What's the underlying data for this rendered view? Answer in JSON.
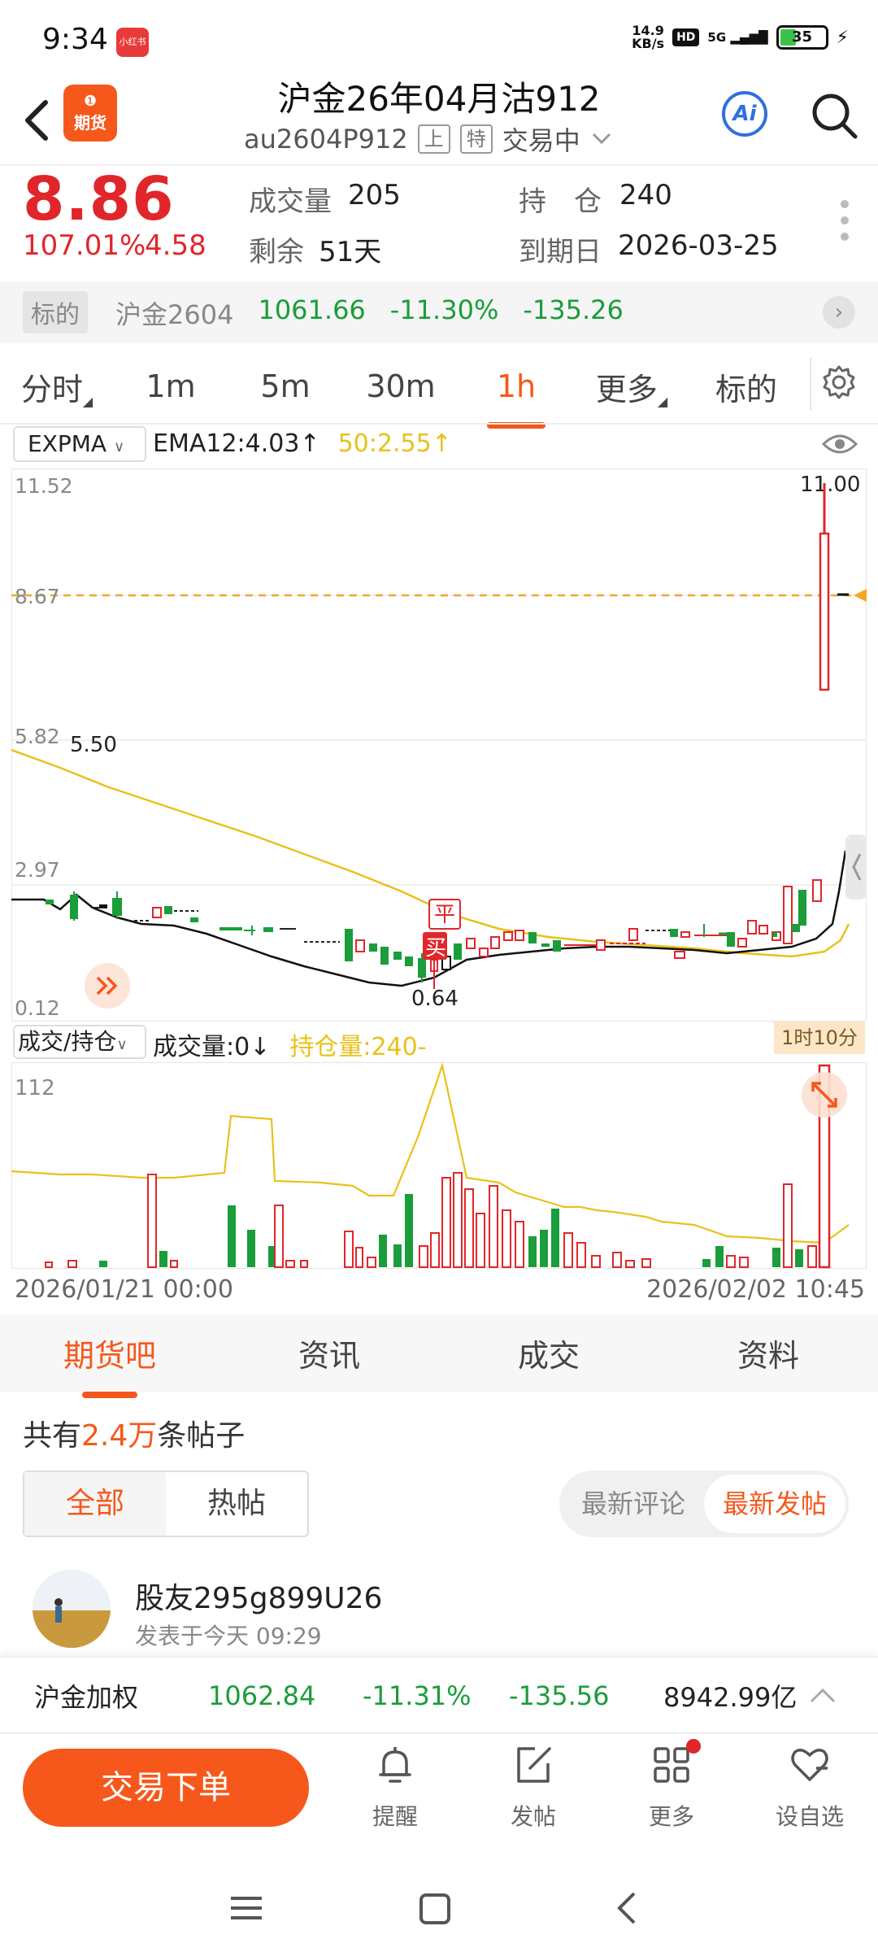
{
  "status": {
    "time": "9:34",
    "app_badge": "小红书",
    "speed_value": "14.9",
    "speed_unit": "KB/s",
    "hd": "HD",
    "network": "5G",
    "battery": "35"
  },
  "header": {
    "logo_line1": "❶",
    "logo_text": "期货",
    "title": "沪金26年04月沽912",
    "code": "au2604P912",
    "tag1": "上",
    "tag2": "特",
    "trade_status": "交易中",
    "ai_label": "Ai"
  },
  "quote": {
    "price": "8.86",
    "pct": "107.01%",
    "change": "4.58",
    "volume_label": "成交量",
    "volume": "205",
    "oi_label": "持　仓",
    "oi": "240",
    "remain_label": "剩余",
    "remain": "51天",
    "expiry_label": "到期日",
    "expiry": "2026-03-25"
  },
  "underlying": {
    "label": "标的",
    "name": "沪金2604",
    "price": "1061.66",
    "pct": "-11.30%",
    "change": "-135.26"
  },
  "period_tabs": [
    "分时",
    "1m",
    "5m",
    "30m",
    "1h",
    "更多",
    "标的"
  ],
  "active_period": "1h",
  "indicator": {
    "name": "EXPMA",
    "ema12": "EMA12:4.03",
    "ema50": "50:2.55"
  },
  "main_chart": {
    "y_ticks": [
      "11.52",
      "8.67",
      "5.82",
      "2.97",
      "0.12"
    ],
    "high_label": "11.00",
    "low_label": "0.64",
    "mid_label": "5.50",
    "flat_badge": "平",
    "buy_badge": "买"
  },
  "volume_panel": {
    "selector": "成交/持仓",
    "volume_label": "成交量:0",
    "oi_label": "持仓量:240-",
    "y_max": "112",
    "time_badge": "1时10分",
    "x_start": "2026/01/21 00:00",
    "x_end": "2026/02/02 10:45"
  },
  "news_tabs": [
    "期货吧",
    "资讯",
    "成交",
    "资料"
  ],
  "posts": {
    "count_prefix": "共有",
    "count": "2.4万",
    "count_suffix": "条帖子",
    "filter_all": "全部",
    "filter_hot": "热帖",
    "sort_comment": "最新评论",
    "sort_post": "最新发帖",
    "first_user": "股友295g899U26",
    "first_time": "发表于今天 09:29"
  },
  "ticker": {
    "name": "沪金加权",
    "price": "1062.84",
    "pct": "-11.31%",
    "change": "-135.56",
    "amount": "8942.99亿"
  },
  "bottom": {
    "trade": "交易下单",
    "remind": "提醒",
    "post": "发帖",
    "more": "更多",
    "watch": "设自选"
  },
  "colors": {
    "accent": "#f6581c",
    "up": "#e0262b",
    "down": "#1a9d3a",
    "ema50": "#e8c21a"
  },
  "chart_data": {
    "type": "candlestick",
    "indicators": {
      "EMA12": 4.03,
      "EMA50": 2.55
    },
    "y_range": [
      0.12,
      11.52
    ],
    "annotations": {
      "high": 11.0,
      "low": 0.64,
      "peak_left": 5.5,
      "last": 8.67
    },
    "volume_max": 112,
    "x_range": [
      "2026/01/21 00:00",
      "2026/02/02 10:45"
    ]
  }
}
